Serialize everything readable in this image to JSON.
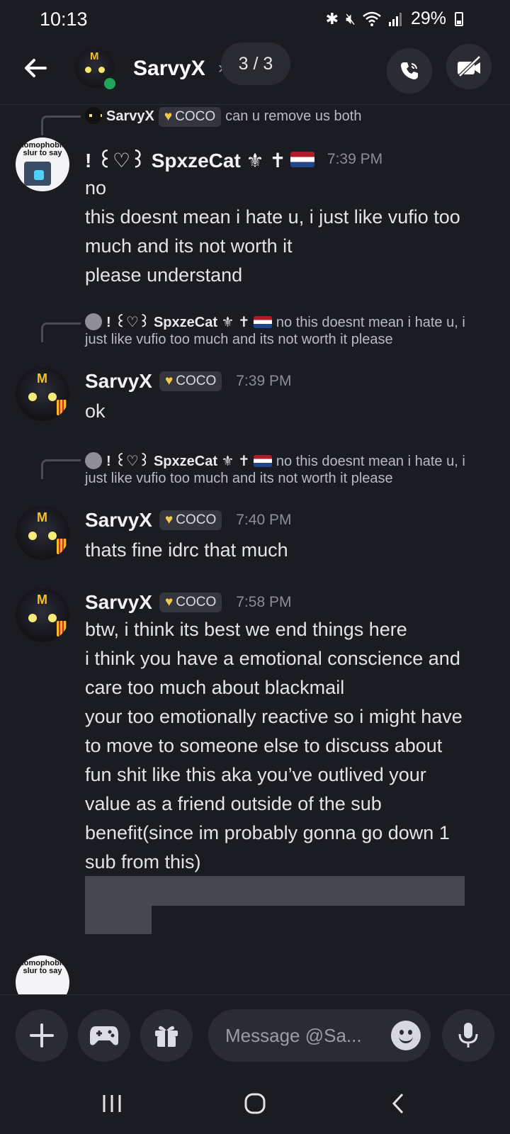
{
  "status": {
    "time": "10:13",
    "battery": "29%"
  },
  "header": {
    "name": "SarvyX",
    "page_indicator": "3 / 3"
  },
  "messages": [
    {
      "reply_to": {
        "name": "SarvyX",
        "tag": "COCO",
        "text": "can u remove us both"
      },
      "author": "! ꒰♡꒱ SpxzeCat ⚜ ✝",
      "time": "7:39 PM",
      "lines": [
        "no",
        "this doesnt mean i hate u, i just like vufio too",
        "much and its not worth it",
        "please understand"
      ]
    },
    {
      "reply_to": {
        "name": "! ꒰♡꒱ SpxzeCat ⚜ ✝",
        "text_1": "no this doesnt mean i hate u, i",
        "text_2": "just like vufio too much and its not worth it please"
      },
      "author": "SarvyX",
      "tag": "COCO",
      "time": "7:39 PM",
      "lines": [
        "ok"
      ]
    },
    {
      "reply_to": {
        "name": "! ꒰♡꒱ SpxzeCat ⚜ ✝",
        "text_1": "no this doesnt mean i hate u, i",
        "text_2": "just like vufio too much and its not worth it please"
      },
      "author": "SarvyX",
      "tag": "COCO",
      "time": "7:40 PM",
      "lines": [
        "thats fine idrc that much"
      ]
    },
    {
      "author": "SarvyX",
      "tag": "COCO",
      "time": "7:58 PM",
      "lines": [
        "btw, i think its best we end things here",
        "i think you have a emotional conscience and",
        "care too much about blackmail",
        "your too emotionally reactive so i might have",
        "to move to someone else to discuss about",
        "fun shit like this aka you’ve outlived your",
        "value as a friend outside of the sub",
        "benefit(since im probably gonna go down 1",
        "sub from this)"
      ]
    }
  ],
  "avatar_text": "homophobic slur to say",
  "composer": {
    "placeholder": "Message @Sa..."
  },
  "icons": {
    "back": "arrow-left-icon",
    "call": "phone-icon",
    "video": "video-off-icon",
    "plus": "plus-icon",
    "games": "gamepad-icon",
    "gift": "gift-icon",
    "emoji": "emoji-icon",
    "mic": "mic-icon"
  },
  "colors": {
    "background": "#1b1c21",
    "online": "#22a559",
    "tag_heart": "#f2c94c"
  }
}
